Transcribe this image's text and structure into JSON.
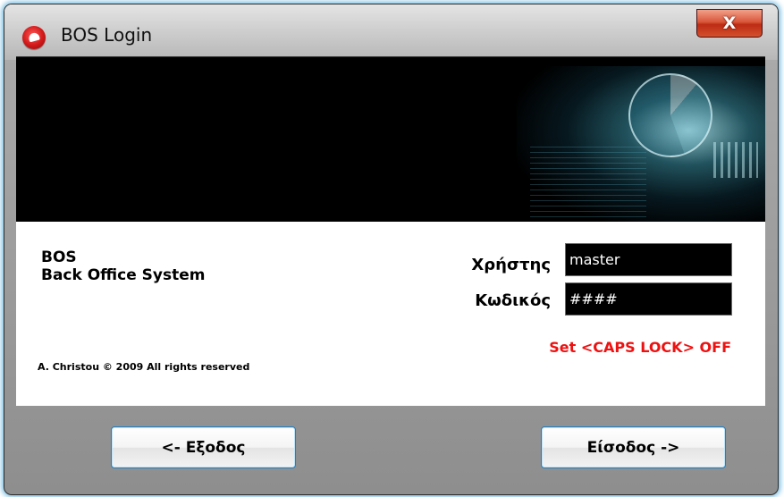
{
  "window": {
    "title": "BOS Login",
    "icon": "bos-app-icon",
    "close_glyph": "X"
  },
  "app": {
    "name_line1": "BOS",
    "name_line2": "Back Office System",
    "copyright": "A. Christou © 2009 All rights reserved"
  },
  "form": {
    "user_label": "Χρήστης",
    "user_value": "master",
    "password_label": "Κωδικός",
    "password_value": "####",
    "caps_warning": "Set <CAPS LOCK> OFF"
  },
  "buttons": {
    "exit_label": "<- Εξοδος",
    "login_label": "Είσοδος ->"
  },
  "colors": {
    "warning": "#ee1111",
    "field_background": "#000000",
    "button_border": "#1f7fc2"
  }
}
